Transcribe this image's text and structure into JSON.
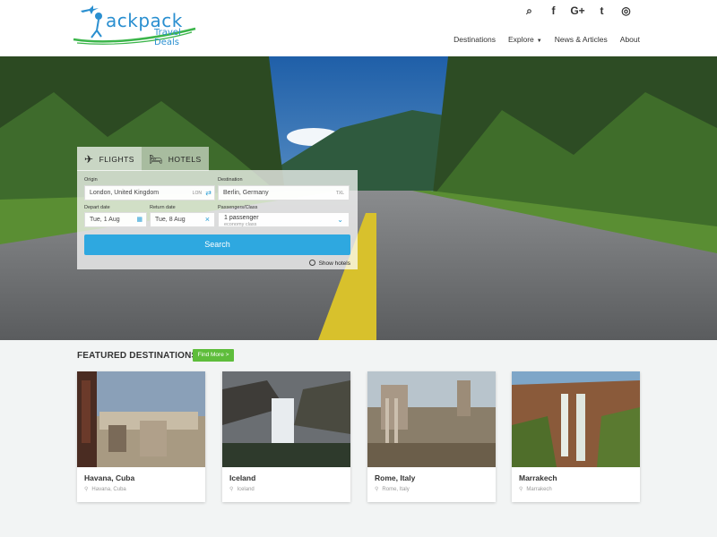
{
  "header": {
    "logo": {
      "name": "ackpack",
      "sub": "Travel Deals"
    },
    "social_icons": [
      {
        "name": "search-icon",
        "glyph": "⌕"
      },
      {
        "name": "facebook-icon",
        "glyph": "f"
      },
      {
        "name": "google-plus-icon",
        "glyph": "G+"
      },
      {
        "name": "twitter-icon",
        "glyph": "🐦"
      },
      {
        "name": "instagram-icon",
        "glyph": "◎"
      }
    ],
    "nav": [
      "Destinations",
      "Explore",
      "News & Articles",
      "About"
    ]
  },
  "search": {
    "tabs": {
      "flights": "FLIGHTS",
      "hotels": "HOTELS"
    },
    "origin": {
      "label": "Origin",
      "value": "London, United Kingdom",
      "code": "LON"
    },
    "destination": {
      "label": "Destination",
      "value": "Berlin, Germany",
      "code": "TXL"
    },
    "depart": {
      "label": "Depart date",
      "value": "Tue, 1 Aug"
    },
    "return": {
      "label": "Return date",
      "value": "Tue, 8 Aug"
    },
    "passengers": {
      "label": "Passengers/Class",
      "value": "1 passenger",
      "sub": "economy class"
    },
    "button": "Search",
    "show_hotels": "Show hotels"
  },
  "featured": {
    "title": "FEATURED DESTINATIONS",
    "find_more": "Find More >",
    "cards": [
      {
        "title": "Havana, Cuba",
        "sub": "Havana, Cuba"
      },
      {
        "title": "Iceland",
        "sub": "Iceland"
      },
      {
        "title": "Rome, Italy",
        "sub": "Rome, Italy"
      },
      {
        "title": "Marrakech",
        "sub": "Marrakech"
      }
    ]
  },
  "colors": {
    "accent": "#2ea8e0",
    "green": "#5ebd3b"
  }
}
